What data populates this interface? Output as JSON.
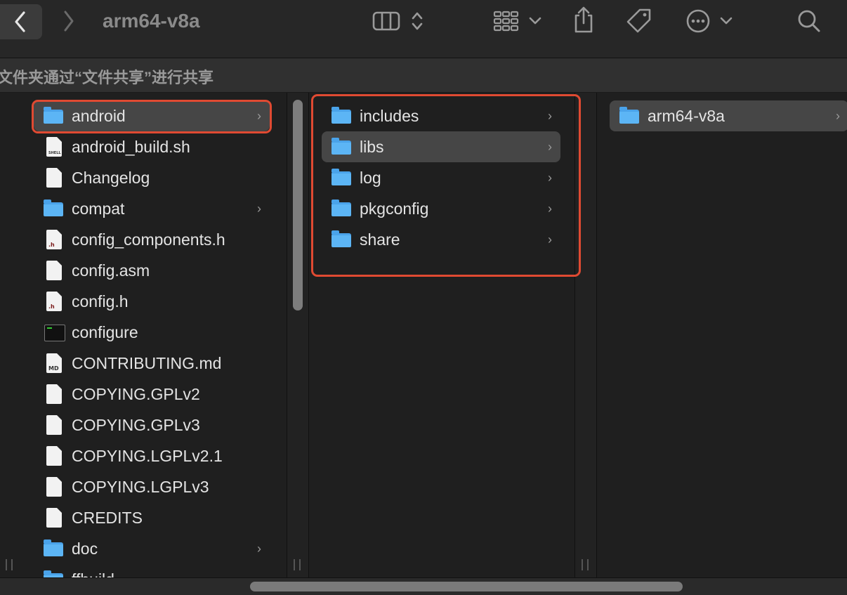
{
  "window": {
    "title": "arm64-v8a",
    "share_banner": "文件夹通过“文件共享”进行共享"
  },
  "toolbar": {
    "icons": [
      "back-icon",
      "forward-icon",
      "column-view-icon",
      "sort-updown-icon",
      "group-grid-icon",
      "chevron-down-icon",
      "share-icon",
      "tag-icon",
      "more-icon",
      "search-icon"
    ]
  },
  "column1": {
    "items": [
      {
        "name": "android",
        "kind": "folder",
        "has_children": true
      },
      {
        "name": "android_build.sh",
        "kind": "shell"
      },
      {
        "name": "Changelog",
        "kind": "doc"
      },
      {
        "name": "compat",
        "kind": "folder",
        "has_children": true
      },
      {
        "name": "config_components.h",
        "kind": "h"
      },
      {
        "name": "config.asm",
        "kind": "doc"
      },
      {
        "name": "config.h",
        "kind": "h"
      },
      {
        "name": "configure",
        "kind": "terminal"
      },
      {
        "name": "CONTRIBUTING.md",
        "kind": "md"
      },
      {
        "name": "COPYING.GPLv2",
        "kind": "doc"
      },
      {
        "name": "COPYING.GPLv3",
        "kind": "doc"
      },
      {
        "name": "COPYING.LGPLv2.1",
        "kind": "doc"
      },
      {
        "name": "COPYING.LGPLv3",
        "kind": "doc"
      },
      {
        "name": "CREDITS",
        "kind": "doc"
      },
      {
        "name": "doc",
        "kind": "folder",
        "has_children": true
      },
      {
        "name": "ffbuild",
        "kind": "folder",
        "has_children": true
      }
    ]
  },
  "column2": {
    "items": [
      {
        "name": "includes",
        "kind": "folder",
        "has_children": true
      },
      {
        "name": "libs",
        "kind": "folder",
        "has_children": true
      },
      {
        "name": "log",
        "kind": "folder",
        "has_children": true
      },
      {
        "name": "pkgconfig",
        "kind": "folder",
        "has_children": true
      },
      {
        "name": "share",
        "kind": "folder",
        "has_children": true
      }
    ]
  },
  "column3": {
    "items": [
      {
        "name": "arm64-v8a",
        "kind": "folder",
        "has_children": true
      }
    ]
  },
  "doc_labels": {
    "h": ".h",
    "md": "MD",
    "shell": "SHELL"
  },
  "colors": {
    "accent_highlight": "#e04a32",
    "folder": "#5cb5f5",
    "selection": "#464646"
  }
}
